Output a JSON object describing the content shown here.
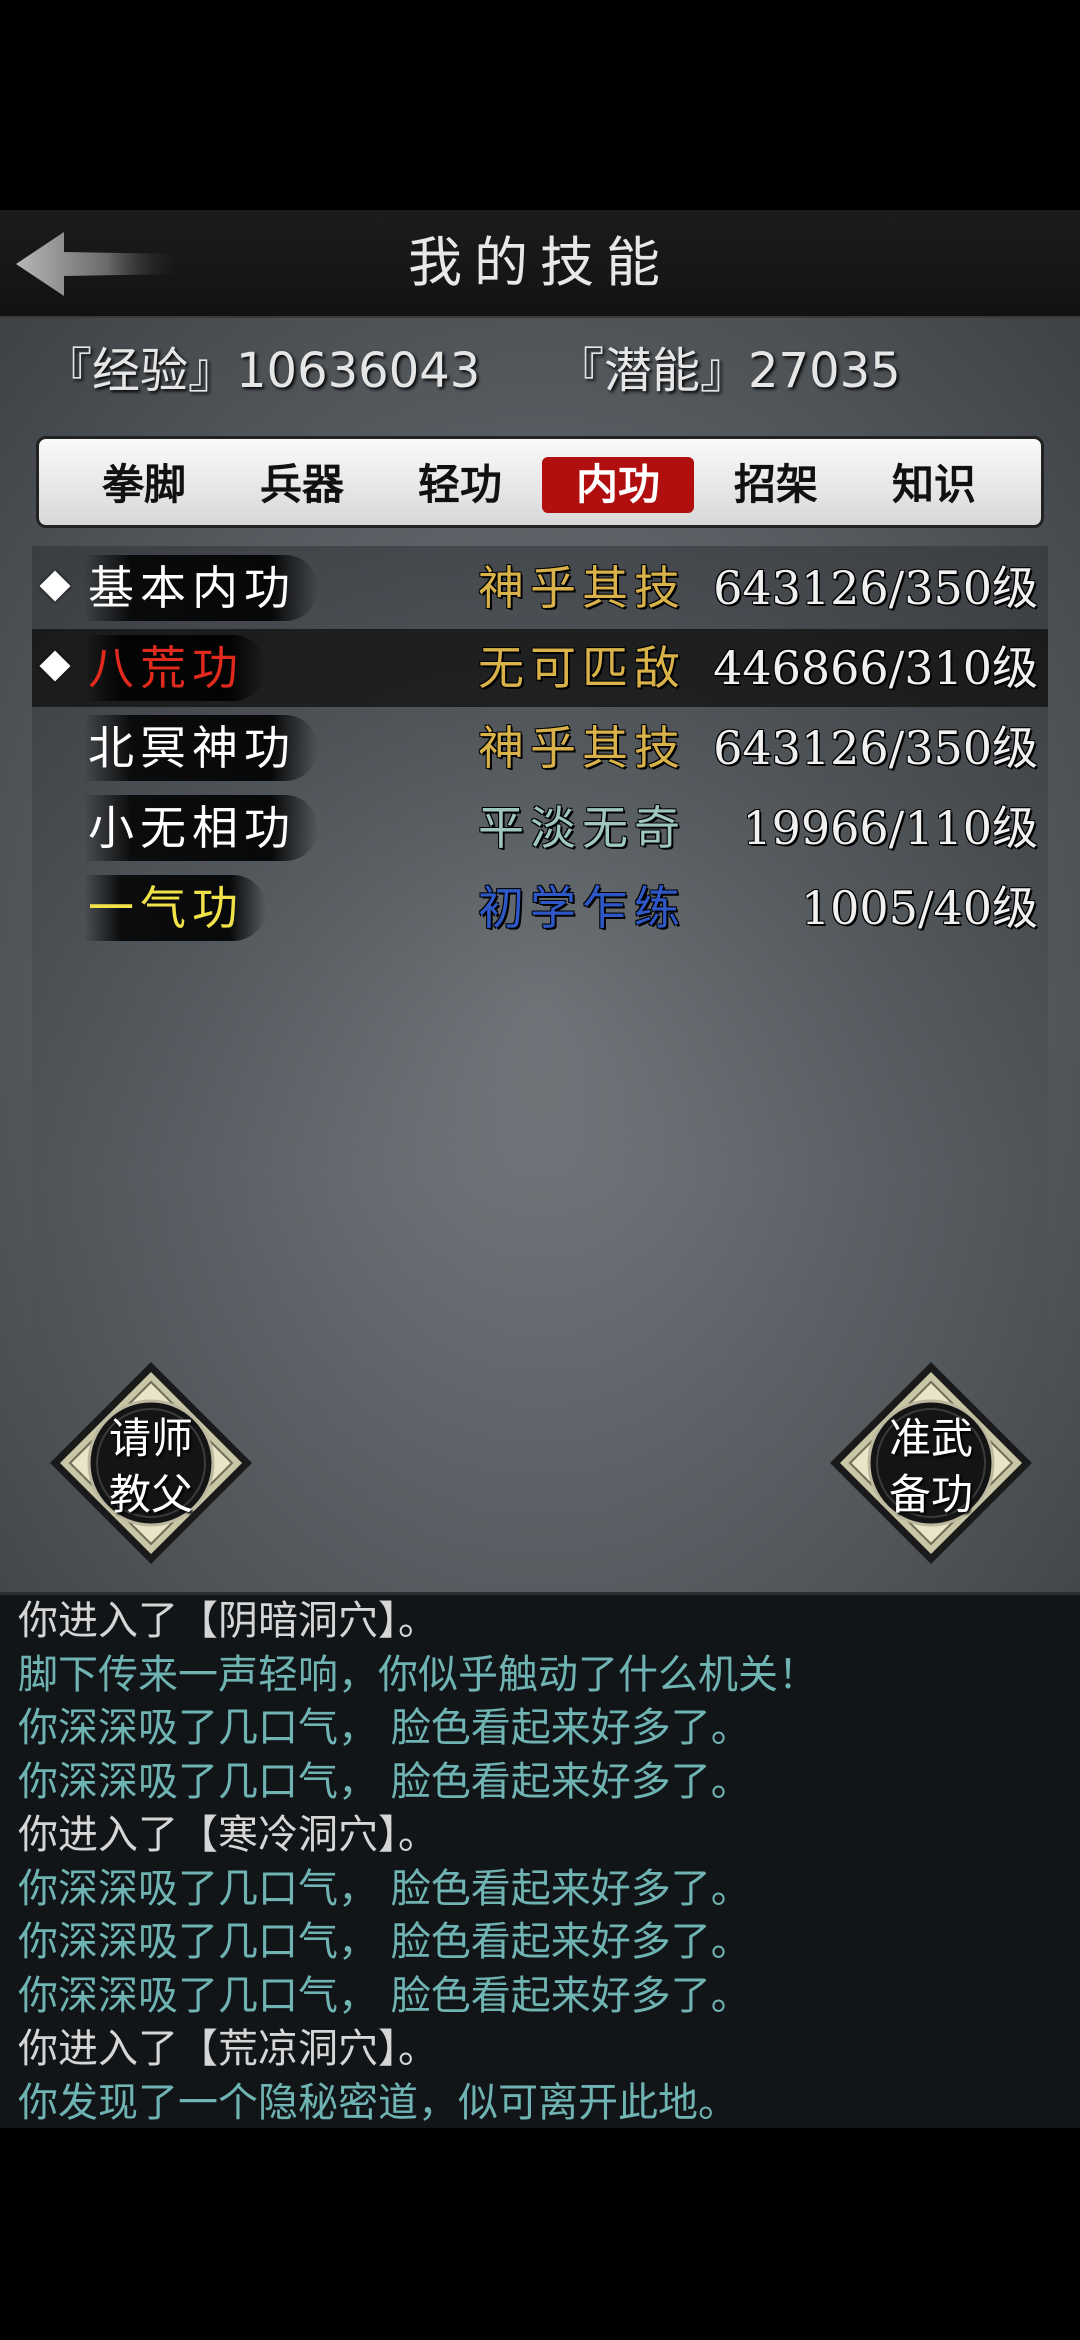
{
  "header": {
    "title": "我的技能"
  },
  "stats": {
    "exp": "『经验』10636043",
    "potential": "『潜能』27035"
  },
  "tabs": [
    {
      "label": "拳脚",
      "active": false
    },
    {
      "label": "兵器",
      "active": false
    },
    {
      "label": "轻功",
      "active": false
    },
    {
      "label": "内功",
      "active": true
    },
    {
      "label": "招架",
      "active": false
    },
    {
      "label": "知识",
      "active": false
    }
  ],
  "skills": [
    {
      "name": "基本内功",
      "name_color": "#ffffff",
      "level": "神乎其技",
      "level_color": "#d9b24a",
      "progress": "643126/350级",
      "marked": true,
      "highlight": false
    },
    {
      "name": "八荒功",
      "name_color": "#e02a1d",
      "level": "无可匹敌",
      "level_color": "#d9b24a",
      "progress": "446866/310级",
      "marked": true,
      "highlight": true
    },
    {
      "name": "北冥神功",
      "name_color": "#ffffff",
      "level": "神乎其技",
      "level_color": "#d9b24a",
      "progress": "643126/350级",
      "marked": false,
      "highlight": false
    },
    {
      "name": "小无相功",
      "name_color": "#ffffff",
      "level": "平淡无奇",
      "level_color": "#9fc7bf",
      "progress": "19966/110级",
      "marked": false,
      "highlight": false
    },
    {
      "name": "一气功",
      "name_color": "#f2e24a",
      "level": "初学乍练",
      "level_color": "#2e58c8",
      "progress": "1005/40级",
      "marked": false,
      "highlight": false
    }
  ],
  "buttons": {
    "left": {
      "line1": "请师",
      "line2": "教父"
    },
    "right": {
      "line1": "准武",
      "line2": "备功"
    }
  },
  "colors": {
    "log_white": "#d6d6d6",
    "log_teal": "#6fb3b3",
    "active_tab": "#b10f0f"
  },
  "log": [
    {
      "text": "你进入了【阴暗洞穴】。",
      "color": "#d6d6d6"
    },
    {
      "text": "脚下传来一声轻响，你似乎触动了什么机关！",
      "color": "#6fb3b3"
    },
    {
      "text": "你深深吸了几口气， 脸色看起来好多了。",
      "color": "#6fb3b3"
    },
    {
      "text": "你深深吸了几口气， 脸色看起来好多了。",
      "color": "#6fb3b3"
    },
    {
      "text": "你进入了【寒冷洞穴】。",
      "color": "#d6d6d6"
    },
    {
      "text": "你深深吸了几口气， 脸色看起来好多了。",
      "color": "#6fb3b3"
    },
    {
      "text": "你深深吸了几口气， 脸色看起来好多了。",
      "color": "#6fb3b3"
    },
    {
      "text": "你深深吸了几口气， 脸色看起来好多了。",
      "color": "#6fb3b3"
    },
    {
      "text": "你进入了【荒凉洞穴】。",
      "color": "#d6d6d6"
    },
    {
      "text": "你发现了一个隐秘密道，似可离开此地。",
      "color": "#6fb3b3"
    }
  ]
}
